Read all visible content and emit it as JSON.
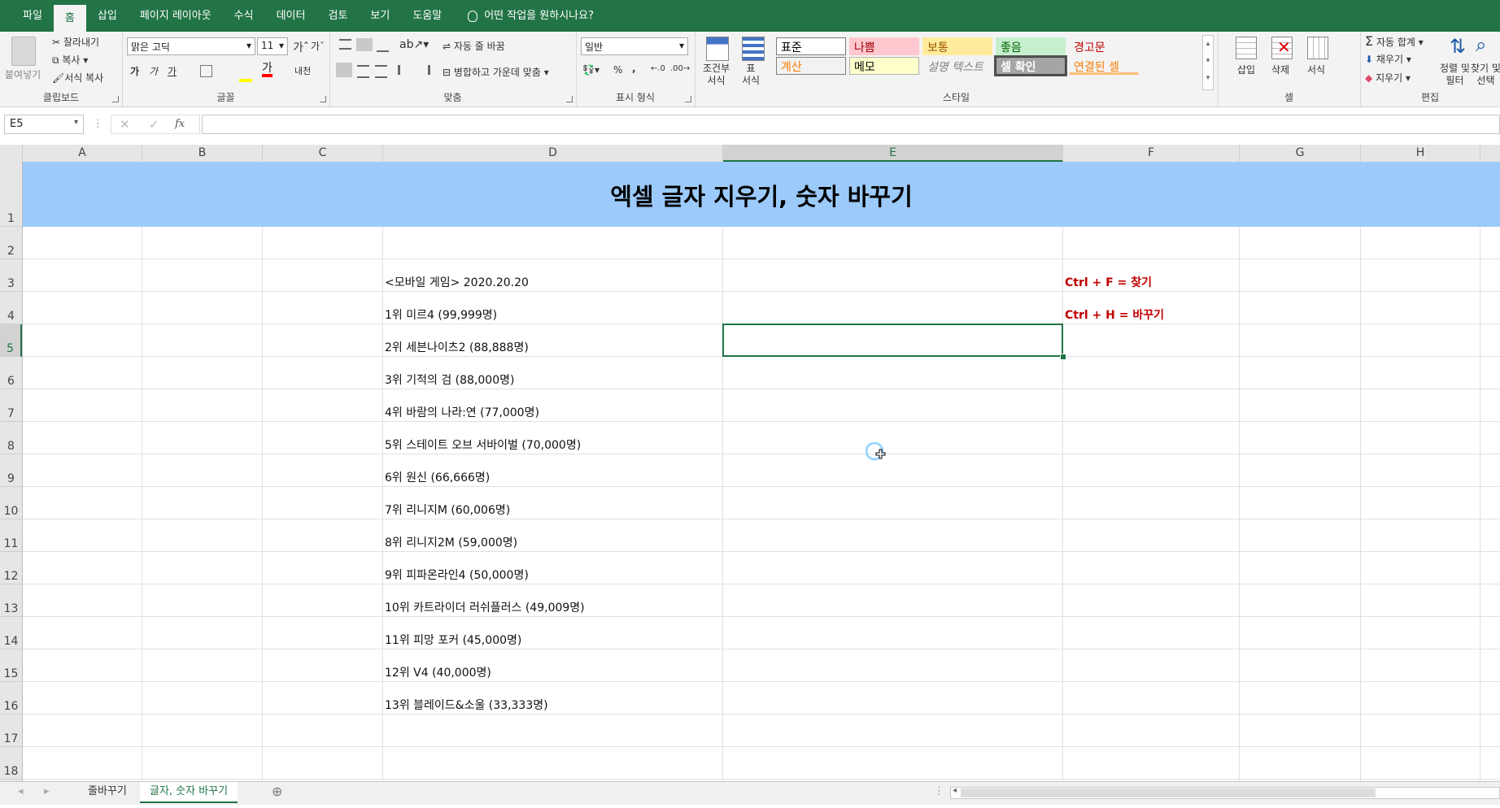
{
  "menu": {
    "tabs": [
      "파일",
      "홈",
      "삽입",
      "페이지 레이아웃",
      "수식",
      "데이터",
      "검토",
      "보기",
      "도움말"
    ],
    "active_index": 1,
    "tell_me": "어떤 작업을 원하시나요?"
  },
  "ribbon": {
    "clipboard": {
      "paste": "붙여넣기",
      "cut": "잘라내기",
      "copy": "복사",
      "format_painter": "서식 복사",
      "label": "클립보드"
    },
    "font": {
      "name": "맑은 고딕",
      "size": "11",
      "bold": "가",
      "italic": "가",
      "underline": "가",
      "label": "글꼴"
    },
    "alignment": {
      "wrap": "자동 줄 바꿈",
      "merge": "병합하고 가운데 맞춤",
      "label": "맞춤"
    },
    "number": {
      "format": "일반",
      "percent": "%",
      "comma": ",",
      "label": "표시 형식"
    },
    "styles": {
      "conditional": "조건부\n서식",
      "table": "표\n서식",
      "cells": [
        {
          "text": "표준",
          "bg": "#ffffff",
          "fg": "#000000",
          "border": "#7a7a7a"
        },
        {
          "text": "나쁨",
          "bg": "#ffc7ce",
          "fg": "#9c0006",
          "border": "#ffc7ce"
        },
        {
          "text": "보통",
          "bg": "#ffeb9c",
          "fg": "#9c5700",
          "border": "#ffeb9c"
        },
        {
          "text": "좋음",
          "bg": "#c6efce",
          "fg": "#006100",
          "border": "#c6efce"
        },
        {
          "text": "경고문",
          "bg": "#f3f3f3",
          "fg": "#c00000",
          "border": "#f3f3f3"
        },
        {
          "text": "계산",
          "bg": "#f2f2f2",
          "fg": "#fa7d00",
          "border": "#7f7f7f"
        },
        {
          "text": "메모",
          "bg": "#ffffcc",
          "fg": "#000000",
          "border": "#b2b2b2"
        },
        {
          "text": "설명 텍스트",
          "bg": "#f3f3f3",
          "fg": "#7f7f7f",
          "border": "#f3f3f3"
        },
        {
          "text": "셀 확인",
          "bg": "#a5a5a5",
          "fg": "#ffffff",
          "border": "#3f3f3f"
        },
        {
          "text": "연결된 셀",
          "bg": "#f3f3f3",
          "fg": "#fa7d00",
          "border": "#f3f3f3"
        }
      ],
      "label": "스타일"
    },
    "cells": {
      "insert": "삽입",
      "delete": "삭제",
      "format": "서식",
      "label": "셀"
    },
    "editing": {
      "autosum": "자동 합계",
      "fill": "채우기",
      "clear": "지우기",
      "sort": "정렬 및\n필터",
      "find": "찾기 및\n선택",
      "label": "편집"
    }
  },
  "formula_bar": {
    "name_box": "E5",
    "fx": "fx",
    "value": ""
  },
  "columns": [
    "A",
    "B",
    "C",
    "D",
    "E",
    "F",
    "G",
    "H"
  ],
  "rows": [
    "1",
    "2",
    "3",
    "4",
    "5",
    "6",
    "7",
    "8",
    "9",
    "10",
    "11",
    "12",
    "13",
    "14",
    "15",
    "16",
    "17",
    "18"
  ],
  "sheet": {
    "title": "엑셀 글자 지우기, 숫자 바꾸기",
    "list": [
      "<모바일 게임> 2020.20.20",
      "1위 미르4 (99,999명)",
      "2위 세븐나이츠2 (88,888명)",
      "3위 기적의 검 (88,000명)",
      "4위 바람의 나라:연 (77,000명)",
      "5위 스테이트 오브 서바이벌 (70,000명)",
      "6위 원신 (66,666명)",
      "7위 리니지M (60,006명)",
      "8위 리니지2M (59,000명)",
      "9위 피파온라인4 (50,000명)",
      "10위 카트라이더 러쉬플러스 (49,009명)",
      "11위 피망 포커 (45,000명)",
      "12위 V4 (40,000명)",
      "13위 블레이드&소울 (33,333명)"
    ],
    "notes": [
      "Ctrl + F = 찾기",
      "Ctrl + H = 바꾸기"
    ]
  },
  "sheet_tabs": [
    "줄바꾸기",
    "글자, 숫자 바꾸기"
  ],
  "active_sheet": 1
}
